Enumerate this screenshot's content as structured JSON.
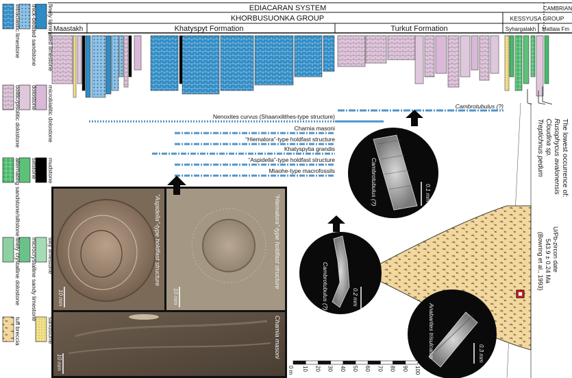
{
  "header": {
    "system": "EDIACARAN SYSTEM",
    "system2": "CAMBRIAN",
    "group1": "KHORBUSUONKA GROUP",
    "group2": "KESSYUSA GROUP"
  },
  "formations": [
    "Maastakh",
    "Khatyspyt Formation",
    "Turkut Formation",
    "Syhargalakh",
    "Mattaia Fm"
  ],
  "legend": [
    {
      "label": "intraclastic limestone",
      "color": "#4f9ccf"
    },
    {
      "label": "thick-bedded sandstone",
      "color": "#8fc2e6"
    },
    {
      "label": "finely laminated limestone",
      "color": "#2f8bc4"
    },
    {
      "label": "oolitic/pisolitic dolostone",
      "color": "#e6d6ea"
    },
    {
      "label": "dolostone",
      "color": "#e0c8dc"
    },
    {
      "label": "microbialitic dolostone",
      "color": "#d9b9d7"
    },
    {
      "label": "alternating sandstone/siltstone",
      "color": "#48b86a"
    },
    {
      "label": "siltstone",
      "color": "#5cc27a"
    },
    {
      "label": "mudstone",
      "color": "#000000"
    },
    {
      "label": "finely crystalline dolostone",
      "color": "#8fd0a2"
    },
    {
      "label": "microcrystalline sandy limestone",
      "color": "#6cc18a"
    },
    {
      "label": "silty limestone",
      "color": "#a5dbb5"
    },
    {
      "label": "tuff breccia",
      "color": "#f2d79e"
    },
    {
      "label": "sandstone",
      "color": "#f3e08a"
    }
  ],
  "ranges": [
    "Cambrotubulus (?)",
    "Nenoxites curvus (Shaanxilithes-type structure)",
    "Charnia masoni",
    "“Hiemalora”-type holdfast structure",
    "Khatyspytia grandis",
    "“Aspidella”-type holdfast structure",
    "Miaohe-type macrofossils"
  ],
  "lowest_occurrence": {
    "title": "The lowest occurrence of:",
    "taxa": [
      "Rusophycus avalonensis",
      "Cloudina sp.",
      "Treptichnus pedum"
    ]
  },
  "photos": {
    "aspidella": "“Aspidella”-type holdfast structure",
    "hiemalora": "“Hiemalora”-type holdfast structure",
    "charnia": "Charnia masoni",
    "scale": "10 mm"
  },
  "sem": [
    {
      "label": "Cambrotubulus (?)",
      "scale": "0.1 mm"
    },
    {
      "label": "Cambrotubulus (?)",
      "scale": "0.2 mm"
    },
    {
      "label": "Anabarites trisulcatus",
      "scale": "0.3 mm"
    }
  ],
  "zircon": [
    "U/Pb-zircon date",
    "543.9 ± 0.24 Ma",
    "(Bowring et al., 1993)"
  ],
  "scalebar": {
    "unit": "0 m",
    "ticks": [
      "10",
      "20",
      "30",
      "40",
      "50",
      "60",
      "70",
      "80",
      "90",
      "100"
    ]
  },
  "colors": {
    "blue": "#2f8bc4",
    "pink": "#e0c8dc",
    "green": "#48b86a",
    "tuff": "#f2d79e",
    "sand": "#f3e08a",
    "range": "#4f93c9",
    "zircon": "#d62020"
  }
}
